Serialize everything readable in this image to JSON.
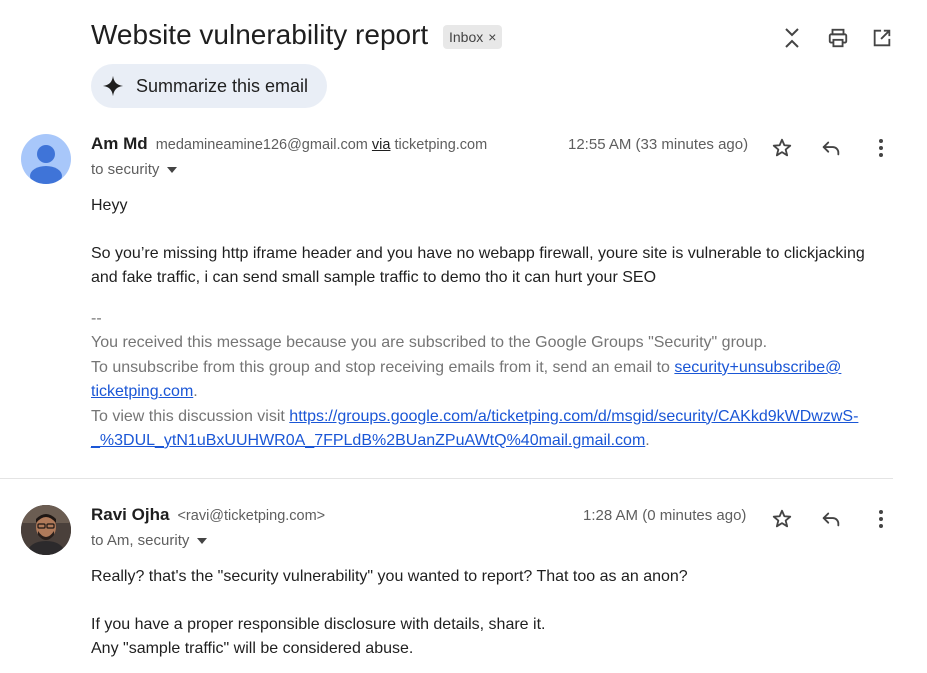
{
  "header": {
    "subject": "Website vulnerability report",
    "label_chip": "Inbox",
    "label_chip_remove": "×",
    "summarize_label": "Summarize this email"
  },
  "messages": [
    {
      "sender_name": "Am Md",
      "sender_email": "medamineamine126@gmail.com",
      "via_label": "via",
      "via_domain": "ticketping.com",
      "to": "to security",
      "time": "12:55 AM (33 minutes ago)",
      "greeting": "Heyy",
      "body": "So you’re missing http iframe header and you have no webapp firewall, youre site is vulnerable to clickjacking and fake traffic, i can send small sample traffic to demo tho it can hurt your SEO",
      "footer": {
        "sig_sep": "--",
        "line1": "You received this message because you are subscribed to the Google Groups \"Security\" group.",
        "line2_prefix": "To unsubscribe from this group and stop receiving emails from it, send an email to ",
        "unsubscribe_link_1": "security+unsubscribe@",
        "unsubscribe_link_2": "ticketping.com",
        "line2_suffix": ".",
        "line3_prefix": "To view this discussion visit ",
        "discussion_link_1": "https://groups.google.com/a/ticketping.com/d/msgid/security/CAKkd9kWDwzwS-",
        "discussion_link_2": "_%3DUL_ytN1uBxUUHWR0A_7FPLdB%2BUanZPuAWtQ%40mail.gmail.com",
        "line3_suffix": "."
      }
    },
    {
      "sender_name": "Ravi Ojha",
      "sender_email": "<ravi@ticketping.com>",
      "to": "to Am, security",
      "time": "1:28 AM (0 minutes ago)",
      "line1": "Really? that's the \"security vulnerability\" you wanted to report? That too as an anon?",
      "line2": "If you have a proper responsible disclosure with details, share it.",
      "line3": "Any \"sample traffic\" will be considered abuse."
    }
  ],
  "colors": {
    "link": "#1a56d6",
    "summarize_bg": "#e9eef6",
    "avatar_default_bg": "#a8c7fa",
    "avatar_default_fg": "#3f74d8"
  },
  "icons": [
    "collapse-icon",
    "print-icon",
    "open-new-window-icon",
    "sparkle-icon",
    "star-icon",
    "reply-icon",
    "more-vert-icon",
    "dropdown-arrow-icon",
    "default-avatar-icon"
  ]
}
